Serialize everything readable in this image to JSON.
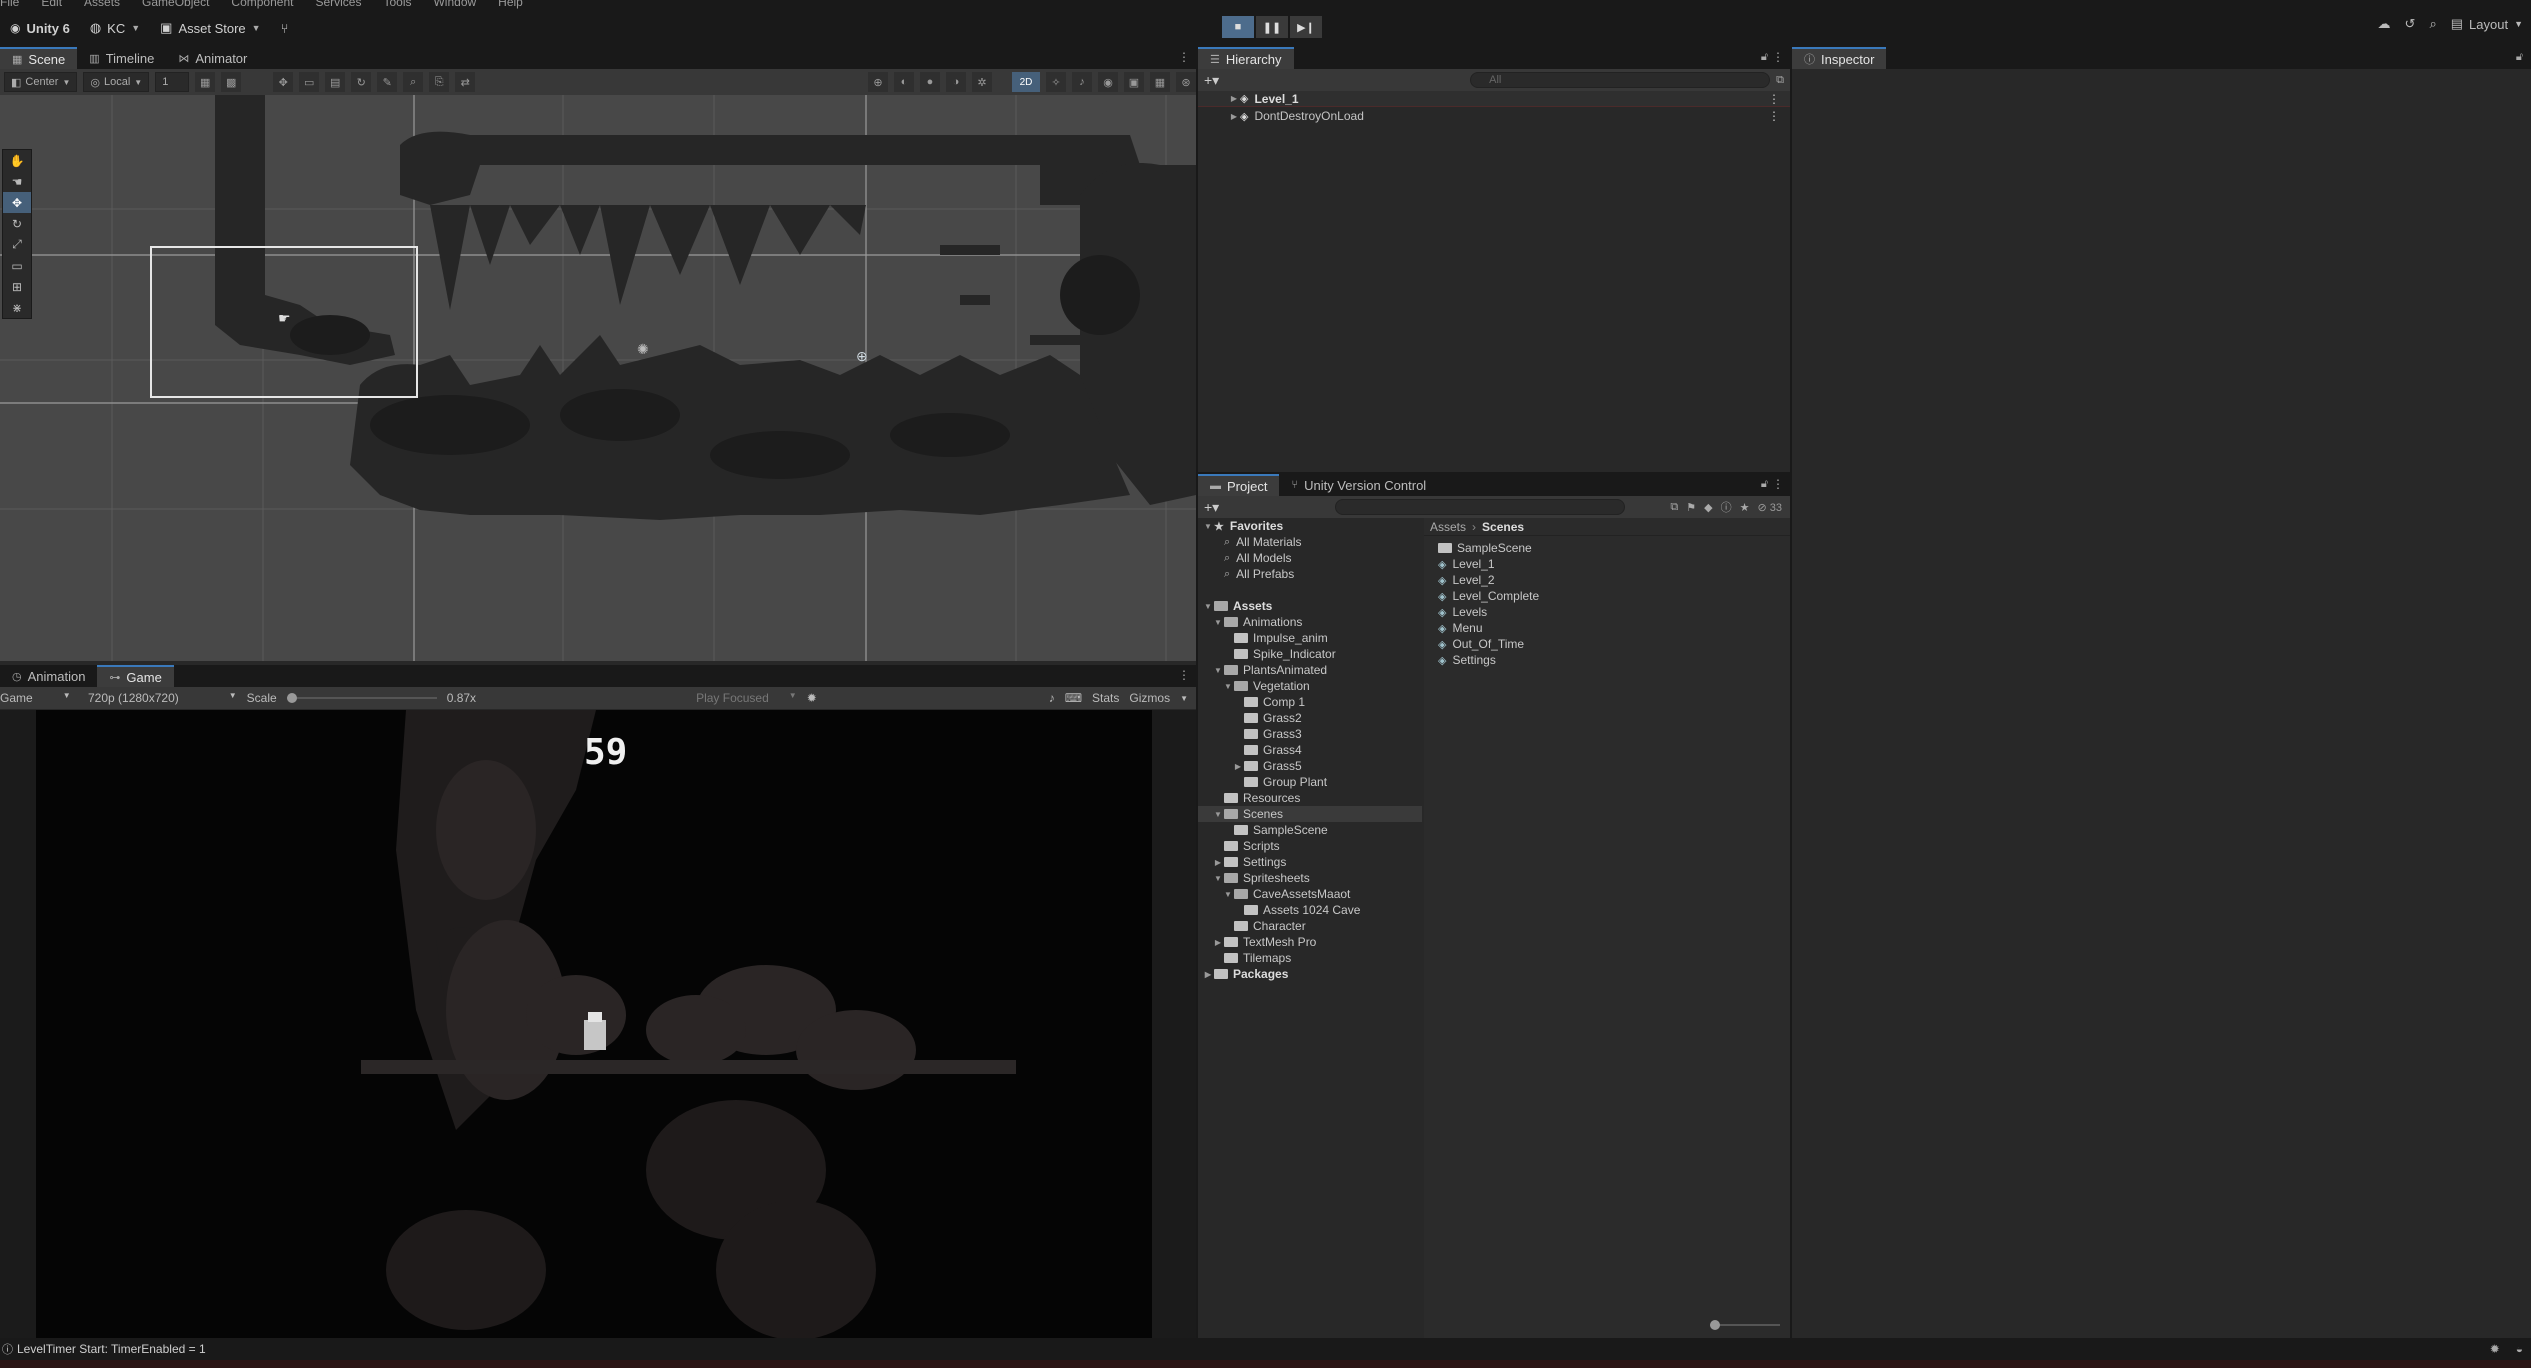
{
  "menu": [
    "File",
    "Edit",
    "Assets",
    "GameObject",
    "Component",
    "Services",
    "Tools",
    "Window",
    "Help"
  ],
  "toolbar": {
    "app_label": "Unity 6",
    "account": "KC",
    "asset_store": "Asset Store",
    "layout": "Layout"
  },
  "scene_panel": {
    "tabs": [
      "Scene",
      "Timeline",
      "Animator"
    ],
    "pivot": "Center",
    "space": "Local",
    "grid_value": "1",
    "mode_2d": "2D"
  },
  "game_panel": {
    "tabs": [
      "Animation",
      "Game"
    ],
    "display": "Game",
    "resolution": "720p (1280x720)",
    "scale_label": "Scale",
    "scale_value": "0.87x",
    "play_focus": "Play Focused",
    "stats": "Stats",
    "gizmos": "Gizmos",
    "timer": "59"
  },
  "hierarchy": {
    "tab": "Hierarchy",
    "search_placeholder": "All",
    "rows": [
      {
        "label": "Level_1"
      },
      {
        "label": "DontDestroyOnLoad"
      }
    ]
  },
  "project": {
    "tabs": [
      "Project",
      "Unity Version Control"
    ],
    "count": "33",
    "tree": [
      {
        "label": "Favorites",
        "level": 0,
        "kind": "star",
        "bold": true
      },
      {
        "label": "All Materials",
        "level": 1,
        "kind": "search"
      },
      {
        "label": "All Models",
        "level": 1,
        "kind": "search"
      },
      {
        "label": "All Prefabs",
        "level": 1,
        "kind": "search"
      },
      {
        "label": "",
        "level": 0,
        "kind": "spacer"
      },
      {
        "label": "Assets",
        "level": 0,
        "kind": "folder-open",
        "bold": true
      },
      {
        "label": "Animations",
        "level": 1,
        "kind": "folder-open"
      },
      {
        "label": "Impulse_anim",
        "level": 2,
        "kind": "folder"
      },
      {
        "label": "Spike_Indicator",
        "level": 2,
        "kind": "folder"
      },
      {
        "label": "PlantsAnimated",
        "level": 1,
        "kind": "folder-open"
      },
      {
        "label": "Vegetation",
        "level": 2,
        "kind": "folder-open"
      },
      {
        "label": "Comp 1",
        "level": 3,
        "kind": "folder"
      },
      {
        "label": "Grass2",
        "level": 3,
        "kind": "folder"
      },
      {
        "label": "Grass3",
        "level": 3,
        "kind": "folder"
      },
      {
        "label": "Grass4",
        "level": 3,
        "kind": "folder"
      },
      {
        "label": "Grass5",
        "level": 3,
        "kind": "folder"
      },
      {
        "label": "Group Plant",
        "level": 3,
        "kind": "folder"
      },
      {
        "label": "Resources",
        "level": 1,
        "kind": "folder"
      },
      {
        "label": "Scenes",
        "level": 1,
        "kind": "folder-open",
        "selected": true
      },
      {
        "label": "SampleScene",
        "level": 2,
        "kind": "folder"
      },
      {
        "label": "Scripts",
        "level": 1,
        "kind": "folder"
      },
      {
        "label": "Settings",
        "level": 1,
        "kind": "folder"
      },
      {
        "label": "Spritesheets",
        "level": 1,
        "kind": "folder-open"
      },
      {
        "label": "CaveAssetsMaaot",
        "level": 2,
        "kind": "folder-open"
      },
      {
        "label": "Assets 1024 Cave",
        "level": 3,
        "kind": "folder"
      },
      {
        "label": "Character",
        "level": 2,
        "kind": "folder"
      },
      {
        "label": "TextMesh Pro",
        "level": 1,
        "kind": "folder"
      },
      {
        "label": "Tilemaps",
        "level": 1,
        "kind": "folder"
      },
      {
        "label": "Packages",
        "level": 0,
        "kind": "folder",
        "bold": true
      }
    ],
    "breadcrumb": [
      "Assets",
      "Scenes"
    ],
    "files": [
      {
        "label": "SampleScene",
        "kind": "folder"
      },
      {
        "label": "Level_1",
        "kind": "scene"
      },
      {
        "label": "Level_2",
        "kind": "scene"
      },
      {
        "label": "Level_Complete",
        "kind": "scene"
      },
      {
        "label": "Levels",
        "kind": "scene"
      },
      {
        "label": "Menu",
        "kind": "scene"
      },
      {
        "label": "Out_Of_Time",
        "kind": "scene"
      },
      {
        "label": "Settings",
        "kind": "scene"
      }
    ]
  },
  "inspector": {
    "tab": "Inspector"
  },
  "status": {
    "message": "LevelTimer Start: TimerEnabled = 1"
  }
}
